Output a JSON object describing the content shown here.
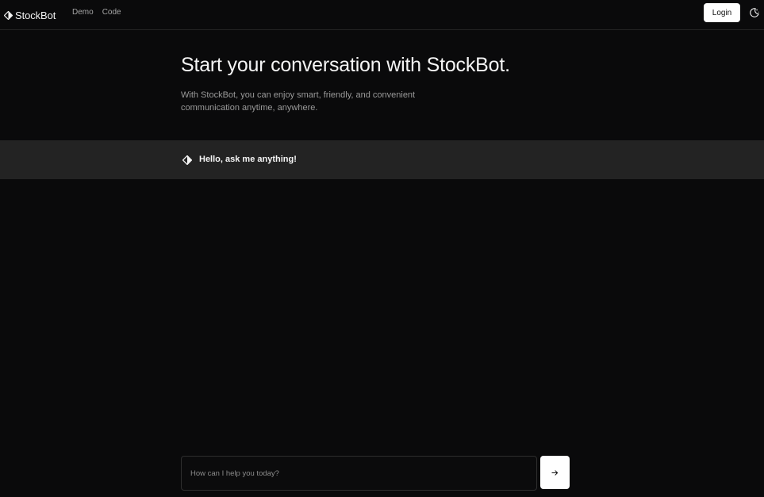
{
  "brand": {
    "name": "StockBot",
    "logo_icon": "diamond-logo-icon"
  },
  "nav": {
    "links": [
      "Demo",
      "Code"
    ],
    "login_label": "Login",
    "theme_icon": "moon-stars-icon"
  },
  "hero": {
    "title": "Start your conversation with StockBot.",
    "subtitle": "With StockBot, you can enjoy smart, friendly, and convenient communication anytime, anywhere."
  },
  "chat": {
    "messages": [
      {
        "role": "assistant",
        "icon": "diamond-logo-icon",
        "text": "Hello, ask me anything!"
      }
    ],
    "input": {
      "value": "",
      "placeholder": "How can I help you today?"
    },
    "send_icon": "arrow-right-icon"
  },
  "colors": {
    "background": "#0a0a0b",
    "greeting_row": "#232323",
    "border": "#242424",
    "button_bg": "#ffffff",
    "muted_text": "#9a9a9a"
  }
}
